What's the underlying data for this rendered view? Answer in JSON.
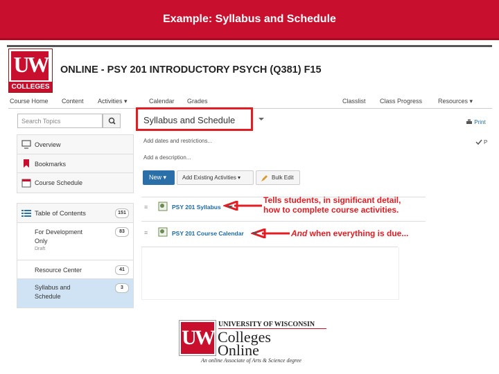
{
  "slide": {
    "title": "Example: Syllabus and Schedule"
  },
  "logo": {
    "letters": "UW",
    "caption": "COLLEGES"
  },
  "course": {
    "title": "ONLINE - PSY 201 INTRODUCTORY PSYCH (Q381) F15"
  },
  "nav": {
    "items": [
      "Course Home",
      "Content",
      "Activities ▾",
      "Calendar",
      "Grades",
      "Classlist",
      "Class Progress",
      "Resources ▾"
    ]
  },
  "sidebar": {
    "search_placeholder": "Search Topics",
    "top_items": [
      {
        "label": "Overview",
        "icon": "overview-icon"
      },
      {
        "label": "Bookmarks",
        "icon": "bookmark-icon"
      },
      {
        "label": "Course Schedule",
        "icon": "calendar-icon"
      }
    ],
    "toc": {
      "label": "Table of Contents",
      "count": "151"
    },
    "modules": [
      {
        "label": "For Development",
        "sub": "Only",
        "status": "Draft",
        "count": "83"
      },
      {
        "label": "Resource Center",
        "count": "41"
      },
      {
        "label": "Syllabus and",
        "sub": "Schedule",
        "count": "3"
      }
    ]
  },
  "main": {
    "heading": "Syllabus and Schedule",
    "add_dates": "Add dates and restrictions...",
    "add_description": "Add a description...",
    "print_label": "Print",
    "toolbar": {
      "new_label": "New ▾",
      "add_existing_label": "Add Existing Activities ▾",
      "bulk_edit_label": "Bulk Edit"
    },
    "topics": [
      {
        "label": "PSY 201 Syllabus"
      },
      {
        "label": "PSY 201 Course Calendar"
      }
    ]
  },
  "callouts": {
    "first_line1": "Tells students, in significant detail,",
    "first_line2": "how to complete course activities.",
    "second_italic": "And",
    "second_rest": " when everything is due..."
  },
  "footer": {
    "letters": "UW",
    "university": "UNIVERSITY OF WISCONSIN",
    "word1": "Colleges",
    "word2": "Online",
    "tagline": "An online Associate of Arts & Science degree"
  },
  "colors": {
    "brand_red": "#c8102e",
    "link_blue": "#1e6aa6",
    "callout_red": "#e31b23"
  }
}
